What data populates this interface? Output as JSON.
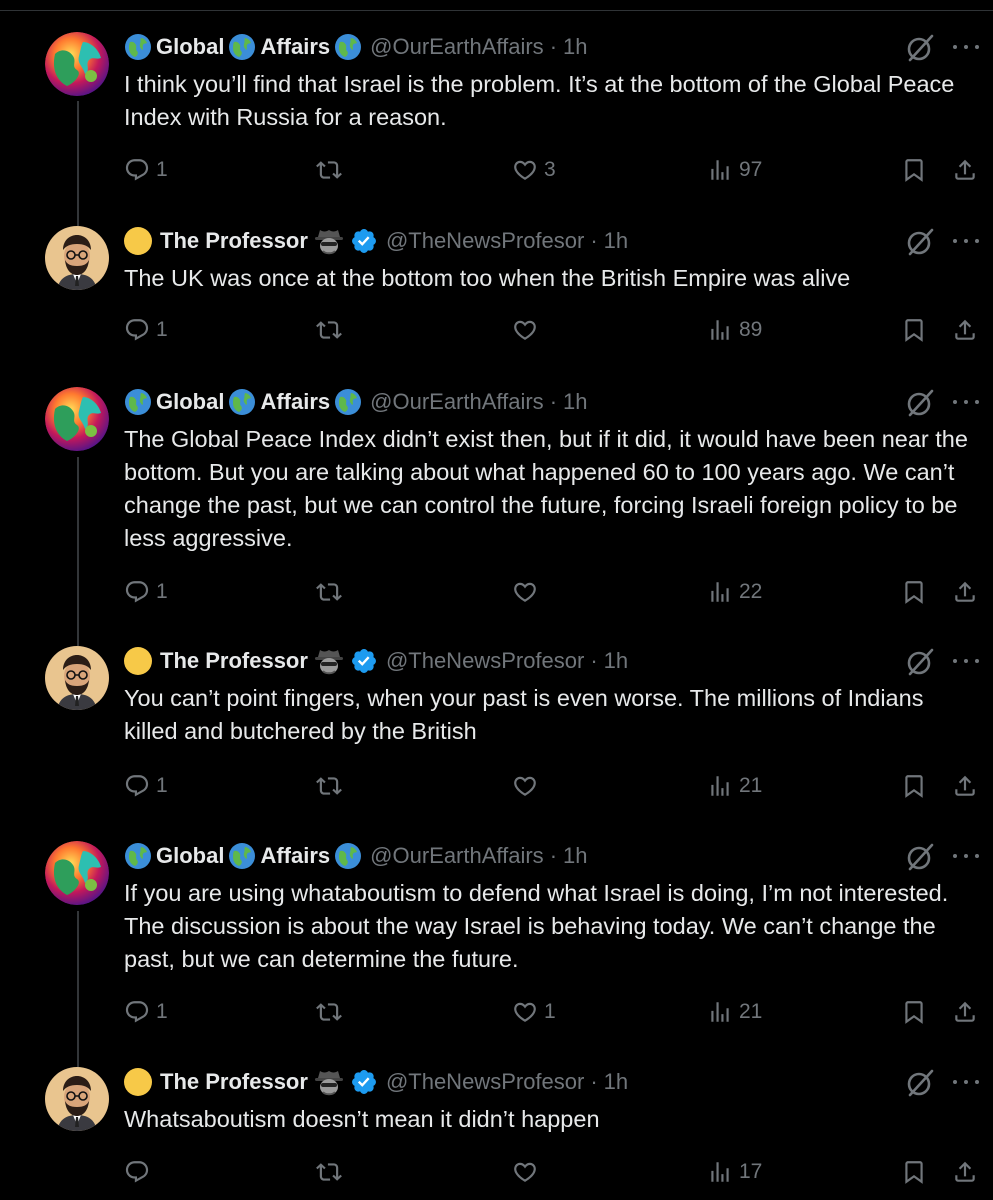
{
  "tweets": [
    {
      "author": "global",
      "name_part1": "Global",
      "name_part2": "Affairs",
      "handle": "@OurEarthAffairs",
      "time": "1h",
      "text": "I think you’ll find that Israel is the problem. It’s at the bottom of the Global Peace Index with Russia for a reason.",
      "replies": "1",
      "reposts": "",
      "likes": "3",
      "views": "97"
    },
    {
      "author": "professor",
      "name": "The Professor",
      "handle": "@TheNewsProfesor",
      "time": "1h",
      "text": "The UK was once at the bottom too when the British Empire was alive",
      "replies": "1",
      "reposts": "",
      "likes": "",
      "views": "89"
    },
    {
      "author": "global",
      "name_part1": "Global",
      "name_part2": "Affairs",
      "handle": "@OurEarthAffairs",
      "time": "1h",
      "text": "The Global Peace Index didn’t exist then, but if it did, it would have been near the bottom. But you are talking about what happened 60 to 100 years ago. We can’t change the past, but we can control the future, forcing Israeli foreign policy to be less aggressive.",
      "replies": "1",
      "reposts": "",
      "likes": "",
      "views": "22"
    },
    {
      "author": "professor",
      "name": "The Professor",
      "handle": "@TheNewsProfesor",
      "time": "1h",
      "text": "You can’t point fingers, when your past is even worse. The millions of Indians killed and butchered by the British",
      "replies": "1",
      "reposts": "",
      "likes": "",
      "views": "21"
    },
    {
      "author": "global",
      "name_part1": "Global",
      "name_part2": "Affairs",
      "handle": "@OurEarthAffairs",
      "time": "1h",
      "text": "If you are using whataboutism to defend what Israel is doing, I’m not interested. The discussion is about the way Israel is behaving today. We can’t change the past, but we can determine the future.",
      "replies": "1",
      "reposts": "",
      "likes": "1",
      "views": "21"
    },
    {
      "author": "professor",
      "name": "The Professor",
      "handle": "@TheNewsProfesor",
      "time": "1h",
      "text": "Whatsaboutism doesn’t mean it didn’t happen",
      "replies": "",
      "reposts": "",
      "likes": "",
      "views": "17"
    }
  ],
  "separator": "·",
  "icons": {
    "reply": "reply-icon",
    "repost": "repost-icon",
    "like": "heart-icon",
    "views": "views-icon",
    "bookmark": "bookmark-icon",
    "share": "share-icon",
    "grok": "grok-icon",
    "more": "more-icon",
    "verified": "verified-badge-icon",
    "globe": "globe-emoji-icon",
    "spy": "detective-emoji-icon",
    "yellow_circle": "yellow-circle-emoji-icon"
  },
  "colors": {
    "background": "#000000",
    "text": "#e7e9ea",
    "muted": "#71767b",
    "verified": "#1d9bf0",
    "thread_line": "#333639"
  }
}
